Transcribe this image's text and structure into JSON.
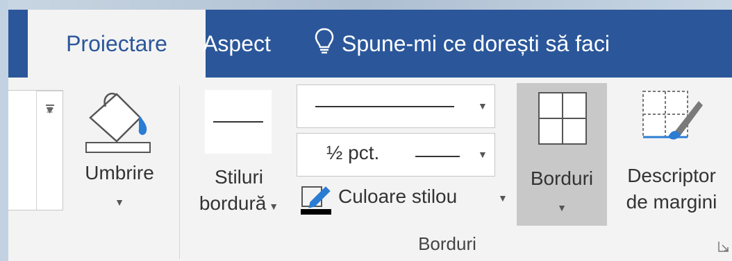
{
  "tabs": {
    "proiectare": "Proiectare",
    "aspect": "Aspect",
    "tell_me": "Spune-mi ce dorești să faci"
  },
  "ribbon": {
    "umbrire": "Umbrire",
    "stiluri_line1": "Stiluri",
    "stiluri_line2": "bordură",
    "line_weight": "½ pct.",
    "pen_color": "Culoare stilou",
    "borduri_btn": "Borduri",
    "descriptor_line1": "Descriptor",
    "descriptor_line2": "de margini",
    "group_label": "Borduri"
  },
  "colors": {
    "accent": "#2b579a",
    "ribbon_bg": "#f3f3f3",
    "pressed": "#c8c8c8"
  },
  "icons": [
    "paint-bucket-icon",
    "lightbulb-icon",
    "borders-grid-icon",
    "border-painter-icon",
    "pen-color-icon"
  ]
}
